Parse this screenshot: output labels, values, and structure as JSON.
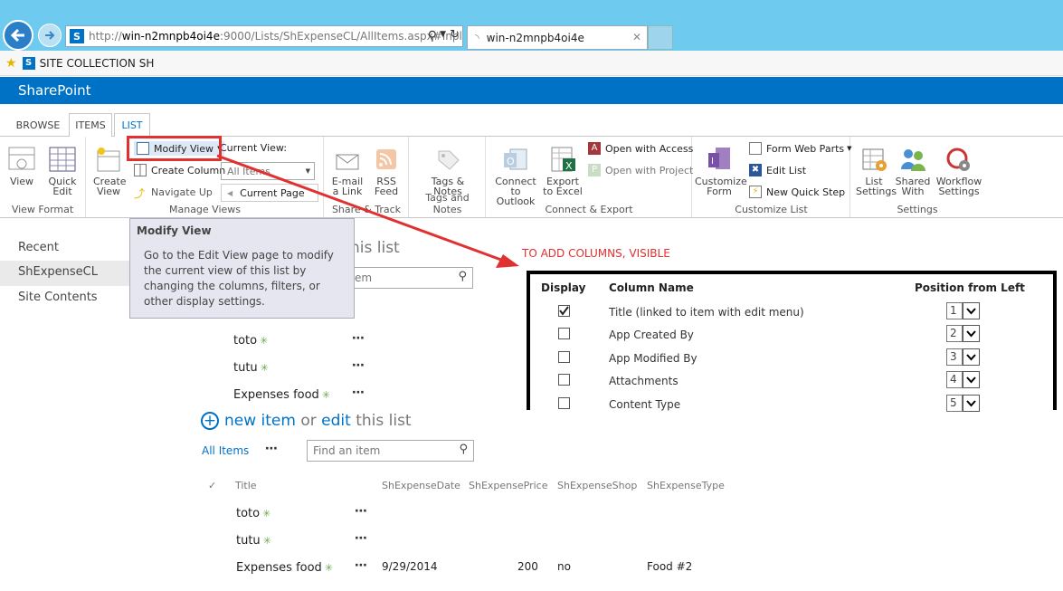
{
  "browser": {
    "url": "http://win-n2mnpb4oi4e:9000/Lists/ShExpenseCL/AllItems.aspx#Inpl",
    "url_host": "win-n2mnpb4oi4e",
    "url_rest": ":9000/Lists/ShExpenseCL/AllItems.aspx#Inpl",
    "url_prefix": "http://",
    "tab_title": "win-n2mnpb4oi4e",
    "favorite": "SITE COLLECTION SH"
  },
  "suite": {
    "brand": "SharePoint"
  },
  "ribbon_tabs": [
    "BROWSE",
    "ITEMS",
    "LIST"
  ],
  "ribbon": {
    "view_format": {
      "label": "View Format",
      "view": "View",
      "quick_edit": "Quick Edit"
    },
    "manage_views": {
      "label": "Manage Views",
      "create_view": "Create View",
      "modify_view": "Modify View",
      "create_column": "Create Column",
      "navigate_up": "Navigate Up",
      "current_view_label": "Current View:",
      "current_view_value": "All Items",
      "current_page": "Current Page"
    },
    "share_track": {
      "label": "Share & Track",
      "email": "E-mail a Link",
      "rss": "RSS Feed"
    },
    "tags_notes": {
      "label": "Tags and Notes",
      "tags": "Tags & Notes"
    },
    "connect_export": {
      "label": "Connect & Export",
      "outlook": "Connect to Outlook",
      "excel": "Export to Excel",
      "access": "Open with Access",
      "project": "Open with Project"
    },
    "customize_list": {
      "label": "Customize List",
      "customize_form": "Customize Form",
      "form_web_parts": "Form Web Parts",
      "edit_list": "Edit List",
      "new_quick_step": "New Quick Step"
    },
    "settings": {
      "label": "Settings",
      "list_settings": "List Settings",
      "shared_with": "Shared With",
      "workflow_settings": "Workflow Settings"
    }
  },
  "tooltip": {
    "title": "Modify View",
    "body": "Go to the Edit View page to modify the current view of this list by changing the columns, filters, or other display settings."
  },
  "left_nav": [
    "Recent",
    "ShExpenseCL",
    "Site Contents"
  ],
  "upper_list": {
    "title_fragment": "his list",
    "search_fragment": "em",
    "items": [
      "toto",
      "tutu",
      "Expenses food"
    ]
  },
  "annotation": "TO ADD COLUMNS, VISIBLE",
  "columns_panel": {
    "headers": {
      "display": "Display",
      "column_name": "Column Name",
      "position": "Position from Left"
    },
    "rows": [
      {
        "checked": true,
        "name": "Title (linked to item with edit menu)",
        "position": "1"
      },
      {
        "checked": false,
        "name": "App Created By",
        "position": "2"
      },
      {
        "checked": false,
        "name": "App Modified By",
        "position": "3"
      },
      {
        "checked": false,
        "name": "Attachments",
        "position": "4"
      },
      {
        "checked": false,
        "name": "Content Type",
        "position": "5"
      }
    ]
  },
  "lower_list": {
    "new_item": "new item",
    "or": "or",
    "edit": "edit",
    "this_list": "this list",
    "view_name": "All Items",
    "search_placeholder": "Find an item",
    "columns": [
      "Title",
      "ShExpenseDate",
      "ShExpensePrice",
      "ShExpenseShop",
      "ShExpenseType"
    ],
    "rows": [
      {
        "title": "toto",
        "date": "",
        "price": "",
        "shop": "",
        "type": ""
      },
      {
        "title": "tutu",
        "date": "",
        "price": "",
        "shop": "",
        "type": ""
      },
      {
        "title": "Expenses food",
        "date": "9/29/2014",
        "price": "200",
        "shop": "no",
        "type": "Food #2"
      }
    ]
  },
  "colors": {
    "accent": "#0072c6",
    "highlight": "#e0302f",
    "new_icon": "#6aa84f"
  }
}
